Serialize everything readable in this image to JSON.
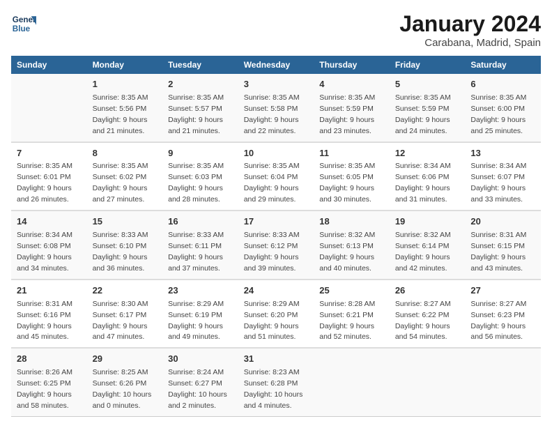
{
  "header": {
    "logo_line1": "General",
    "logo_line2": "Blue",
    "title": "January 2024",
    "subtitle": "Carabana, Madrid, Spain"
  },
  "days_of_week": [
    "Sunday",
    "Monday",
    "Tuesday",
    "Wednesday",
    "Thursday",
    "Friday",
    "Saturday"
  ],
  "weeks": [
    [
      {
        "day": "",
        "sunrise": "",
        "sunset": "",
        "daylight": ""
      },
      {
        "day": "1",
        "sunrise": "Sunrise: 8:35 AM",
        "sunset": "Sunset: 5:56 PM",
        "daylight": "Daylight: 9 hours and 21 minutes."
      },
      {
        "day": "2",
        "sunrise": "Sunrise: 8:35 AM",
        "sunset": "Sunset: 5:57 PM",
        "daylight": "Daylight: 9 hours and 21 minutes."
      },
      {
        "day": "3",
        "sunrise": "Sunrise: 8:35 AM",
        "sunset": "Sunset: 5:58 PM",
        "daylight": "Daylight: 9 hours and 22 minutes."
      },
      {
        "day": "4",
        "sunrise": "Sunrise: 8:35 AM",
        "sunset": "Sunset: 5:59 PM",
        "daylight": "Daylight: 9 hours and 23 minutes."
      },
      {
        "day": "5",
        "sunrise": "Sunrise: 8:35 AM",
        "sunset": "Sunset: 5:59 PM",
        "daylight": "Daylight: 9 hours and 24 minutes."
      },
      {
        "day": "6",
        "sunrise": "Sunrise: 8:35 AM",
        "sunset": "Sunset: 6:00 PM",
        "daylight": "Daylight: 9 hours and 25 minutes."
      }
    ],
    [
      {
        "day": "7",
        "sunrise": "Sunrise: 8:35 AM",
        "sunset": "Sunset: 6:01 PM",
        "daylight": "Daylight: 9 hours and 26 minutes."
      },
      {
        "day": "8",
        "sunrise": "Sunrise: 8:35 AM",
        "sunset": "Sunset: 6:02 PM",
        "daylight": "Daylight: 9 hours and 27 minutes."
      },
      {
        "day": "9",
        "sunrise": "Sunrise: 8:35 AM",
        "sunset": "Sunset: 6:03 PM",
        "daylight": "Daylight: 9 hours and 28 minutes."
      },
      {
        "day": "10",
        "sunrise": "Sunrise: 8:35 AM",
        "sunset": "Sunset: 6:04 PM",
        "daylight": "Daylight: 9 hours and 29 minutes."
      },
      {
        "day": "11",
        "sunrise": "Sunrise: 8:35 AM",
        "sunset": "Sunset: 6:05 PM",
        "daylight": "Daylight: 9 hours and 30 minutes."
      },
      {
        "day": "12",
        "sunrise": "Sunrise: 8:34 AM",
        "sunset": "Sunset: 6:06 PM",
        "daylight": "Daylight: 9 hours and 31 minutes."
      },
      {
        "day": "13",
        "sunrise": "Sunrise: 8:34 AM",
        "sunset": "Sunset: 6:07 PM",
        "daylight": "Daylight: 9 hours and 33 minutes."
      }
    ],
    [
      {
        "day": "14",
        "sunrise": "Sunrise: 8:34 AM",
        "sunset": "Sunset: 6:08 PM",
        "daylight": "Daylight: 9 hours and 34 minutes."
      },
      {
        "day": "15",
        "sunrise": "Sunrise: 8:33 AM",
        "sunset": "Sunset: 6:10 PM",
        "daylight": "Daylight: 9 hours and 36 minutes."
      },
      {
        "day": "16",
        "sunrise": "Sunrise: 8:33 AM",
        "sunset": "Sunset: 6:11 PM",
        "daylight": "Daylight: 9 hours and 37 minutes."
      },
      {
        "day": "17",
        "sunrise": "Sunrise: 8:33 AM",
        "sunset": "Sunset: 6:12 PM",
        "daylight": "Daylight: 9 hours and 39 minutes."
      },
      {
        "day": "18",
        "sunrise": "Sunrise: 8:32 AM",
        "sunset": "Sunset: 6:13 PM",
        "daylight": "Daylight: 9 hours and 40 minutes."
      },
      {
        "day": "19",
        "sunrise": "Sunrise: 8:32 AM",
        "sunset": "Sunset: 6:14 PM",
        "daylight": "Daylight: 9 hours and 42 minutes."
      },
      {
        "day": "20",
        "sunrise": "Sunrise: 8:31 AM",
        "sunset": "Sunset: 6:15 PM",
        "daylight": "Daylight: 9 hours and 43 minutes."
      }
    ],
    [
      {
        "day": "21",
        "sunrise": "Sunrise: 8:31 AM",
        "sunset": "Sunset: 6:16 PM",
        "daylight": "Daylight: 9 hours and 45 minutes."
      },
      {
        "day": "22",
        "sunrise": "Sunrise: 8:30 AM",
        "sunset": "Sunset: 6:17 PM",
        "daylight": "Daylight: 9 hours and 47 minutes."
      },
      {
        "day": "23",
        "sunrise": "Sunrise: 8:29 AM",
        "sunset": "Sunset: 6:19 PM",
        "daylight": "Daylight: 9 hours and 49 minutes."
      },
      {
        "day": "24",
        "sunrise": "Sunrise: 8:29 AM",
        "sunset": "Sunset: 6:20 PM",
        "daylight": "Daylight: 9 hours and 51 minutes."
      },
      {
        "day": "25",
        "sunrise": "Sunrise: 8:28 AM",
        "sunset": "Sunset: 6:21 PM",
        "daylight": "Daylight: 9 hours and 52 minutes."
      },
      {
        "day": "26",
        "sunrise": "Sunrise: 8:27 AM",
        "sunset": "Sunset: 6:22 PM",
        "daylight": "Daylight: 9 hours and 54 minutes."
      },
      {
        "day": "27",
        "sunrise": "Sunrise: 8:27 AM",
        "sunset": "Sunset: 6:23 PM",
        "daylight": "Daylight: 9 hours and 56 minutes."
      }
    ],
    [
      {
        "day": "28",
        "sunrise": "Sunrise: 8:26 AM",
        "sunset": "Sunset: 6:25 PM",
        "daylight": "Daylight: 9 hours and 58 minutes."
      },
      {
        "day": "29",
        "sunrise": "Sunrise: 8:25 AM",
        "sunset": "Sunset: 6:26 PM",
        "daylight": "Daylight: 10 hours and 0 minutes."
      },
      {
        "day": "30",
        "sunrise": "Sunrise: 8:24 AM",
        "sunset": "Sunset: 6:27 PM",
        "daylight": "Daylight: 10 hours and 2 minutes."
      },
      {
        "day": "31",
        "sunrise": "Sunrise: 8:23 AM",
        "sunset": "Sunset: 6:28 PM",
        "daylight": "Daylight: 10 hours and 4 minutes."
      },
      {
        "day": "",
        "sunrise": "",
        "sunset": "",
        "daylight": ""
      },
      {
        "day": "",
        "sunrise": "",
        "sunset": "",
        "daylight": ""
      },
      {
        "day": "",
        "sunrise": "",
        "sunset": "",
        "daylight": ""
      }
    ]
  ]
}
